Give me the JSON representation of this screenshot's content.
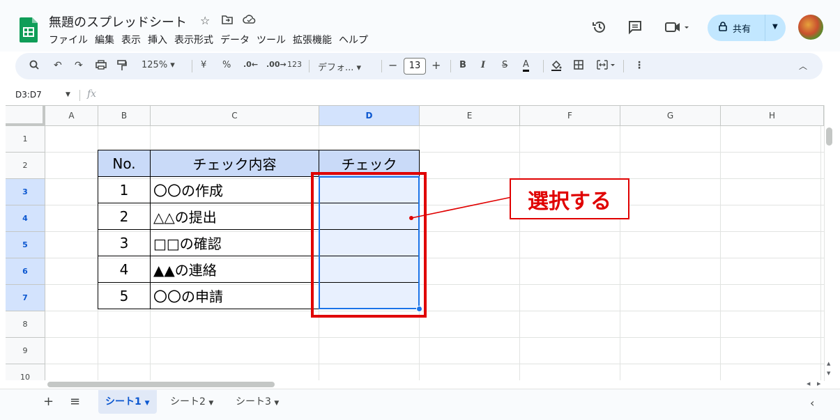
{
  "app": {
    "doc_title": "無題のスプレッドシート",
    "menu": [
      "ファイル",
      "編集",
      "表示",
      "挿入",
      "表示形式",
      "データ",
      "ツール",
      "拡張機能",
      "ヘルプ"
    ],
    "share_label": "共有",
    "star_icon": "☆",
    "move_icon": "⊡",
    "cloud_icon": "☁"
  },
  "toolbar": {
    "zoom": "125%",
    "currency": "¥",
    "percent": "%",
    "dec_decrease": ".0←",
    "dec_increase": ".00→",
    "format_123": "123",
    "font": "デフォ...",
    "font_size": "13",
    "bold": "B",
    "italic": "I",
    "strike": "S",
    "text_color": "A"
  },
  "formula": {
    "name_box": "D3:D7",
    "fx": "fx"
  },
  "grid": {
    "columns": [
      "A",
      "B",
      "C",
      "D",
      "E",
      "F",
      "G",
      "H"
    ],
    "rows": [
      "1",
      "2",
      "3",
      "4",
      "5",
      "6",
      "7",
      "8",
      "9",
      "10"
    ],
    "selected_column": "D",
    "selected_rows": [
      "3",
      "4",
      "5",
      "6",
      "7"
    ],
    "table": {
      "headers": [
        "No.",
        "チェック内容",
        "チェック"
      ],
      "rows": [
        {
          "no": "1",
          "content": "〇〇の作成",
          "check": ""
        },
        {
          "no": "2",
          "content": "△△の提出",
          "check": ""
        },
        {
          "no": "3",
          "content": "□□の確認",
          "check": ""
        },
        {
          "no": "4",
          "content": "▲▲の連絡",
          "check": ""
        },
        {
          "no": "5",
          "content": "〇〇の申請",
          "check": ""
        }
      ]
    }
  },
  "annotation": {
    "label": "選択する",
    "color": "#e00000"
  },
  "sheets": {
    "tabs": [
      "シート1",
      "シート2",
      "シート3"
    ],
    "active": "シート1"
  }
}
